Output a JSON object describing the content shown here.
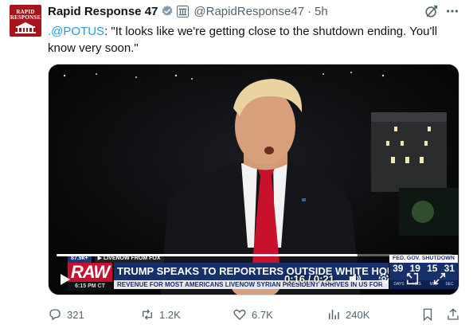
{
  "author": {
    "display_name": "Rapid Response 47",
    "handle": "@RapidResponse47",
    "time": "5h",
    "separator": "·",
    "avatar_text": "RAPID RESPONSE"
  },
  "tweet": {
    "mention": ".@POTUS",
    "body": ": \"It looks like we're getting close to the shutdown ending. You'll know very soon.\""
  },
  "video": {
    "viewers": "87.9k+",
    "live_tag": "▶ LIVENOW FROM FOX",
    "bug": "RAW",
    "clock": "6:15 PM CT",
    "headline": "TRUMP SPEAKS TO REPORTERS OUTSIDE WHITE HOUSE",
    "subline": "REVENUE FOR MOST AMERICANS   LIVENOW   SYRIAN PRESIDENT ARRIVES IN US FOR",
    "shutdown_label": "FED. GOV. SHUTDOWN",
    "countdown": [
      "39",
      "19",
      "15",
      "31"
    ],
    "countdown_units": [
      "DAYS",
      "HRS",
      "MIN",
      "SEC"
    ],
    "elapsed_time": "0:16 / 0:21",
    "progress_fraction": 0.76
  },
  "actions": {
    "replies": "321",
    "reposts": "1.2K",
    "likes": "6.7K",
    "views": "240K"
  },
  "colors": {
    "link": "#1d9bf0",
    "muted": "#536471",
    "verified": "#829aab",
    "raw_red": "#c8102e",
    "news_blue": "#16306a"
  }
}
